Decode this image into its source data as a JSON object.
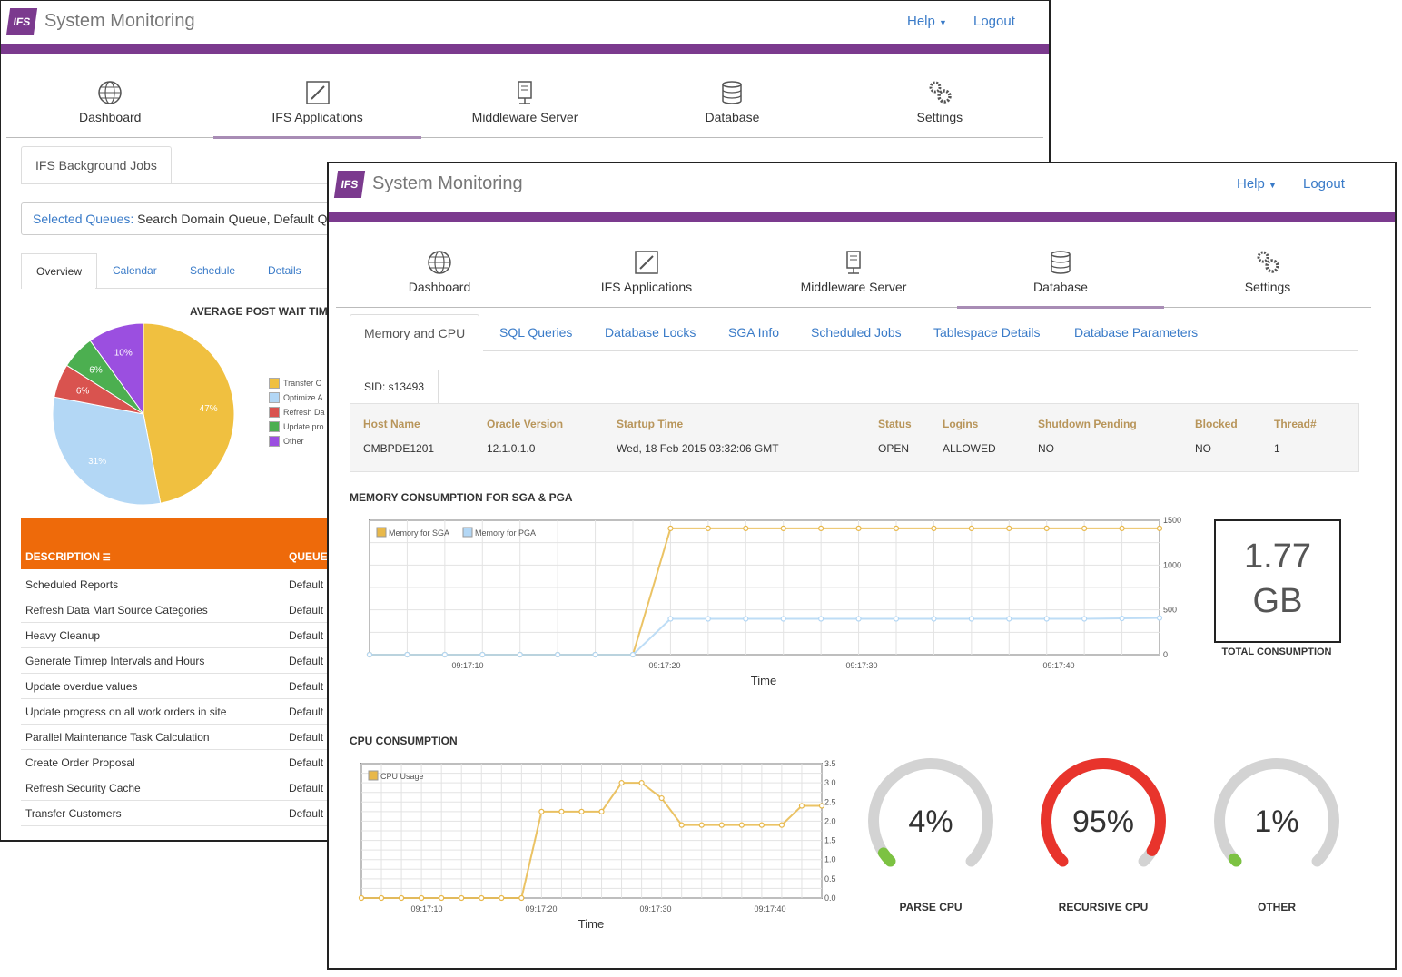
{
  "app": {
    "title": "System Monitoring",
    "logo_text": "IFS",
    "help": "Help",
    "logout": "Logout"
  },
  "nav": [
    {
      "label": "Dashboard",
      "icon": "globe-icon"
    },
    {
      "label": "IFS Applications",
      "icon": "ifs-logo-icon"
    },
    {
      "label": "Middleware Server",
      "icon": "server-icon"
    },
    {
      "label": "Database",
      "icon": "database-icon"
    },
    {
      "label": "Settings",
      "icon": "gears-icon"
    }
  ],
  "back": {
    "page_tab": "IFS Background Jobs",
    "selected_queues_label": "Selected Queues:",
    "selected_queues_value": " Search Domain Queue, Default Q",
    "tabs": [
      "Overview",
      "Calendar",
      "Schedule",
      "Details"
    ],
    "pie_title": "AVERAGE POST WAIT TIM",
    "pie": {
      "slices": [
        {
          "label": "47%",
          "value": 47,
          "color": "#f0c040",
          "legend": "Transfer C"
        },
        {
          "label": "31%",
          "value": 31,
          "color": "#b3d7f5",
          "legend": "Optimize A"
        },
        {
          "label": "6%",
          "value": 6,
          "color": "#d9534f",
          "legend": "Refresh Da"
        },
        {
          "label": "6%",
          "value": 6,
          "color": "#4caf50",
          "legend": "Update pro"
        },
        {
          "label": "10%",
          "value": 10,
          "color": "#9b4fe0",
          "legend": "Other"
        }
      ]
    },
    "table": {
      "col_description": "DESCRIPTION",
      "col_queue": "QUEUE",
      "rows": [
        {
          "d": "Scheduled Reports",
          "q": "Default"
        },
        {
          "d": "Refresh Data Mart Source Categories",
          "q": "Default"
        },
        {
          "d": "Heavy Cleanup",
          "q": "Default"
        },
        {
          "d": "Generate Timrep Intervals and Hours",
          "q": "Default"
        },
        {
          "d": "Update overdue values",
          "q": "Default"
        },
        {
          "d": "Update progress on all work orders in site",
          "q": "Default"
        },
        {
          "d": "Parallel Maintenance Task Calculation",
          "q": "Default"
        },
        {
          "d": "Create Order Proposal",
          "q": "Default"
        },
        {
          "d": "Refresh Security Cache",
          "q": "Default"
        },
        {
          "d": "Transfer Customers",
          "q": "Default"
        }
      ]
    }
  },
  "front": {
    "subtabs": [
      "Memory and CPU",
      "SQL Queries",
      "Database Locks",
      "SGA Info",
      "Scheduled Jobs",
      "Tablespace Details",
      "Database Parameters"
    ],
    "sid_tab": "SID: s13493",
    "info_headers": [
      "Host Name",
      "Oracle Version",
      "Startup Time",
      "Status",
      "Logins",
      "Shutdown Pending",
      "Blocked",
      "Thread#"
    ],
    "info_values": [
      "CMBPDE1201",
      "12.1.0.1.0",
      "Wed, 18 Feb 2015 03:32:06 GMT",
      "OPEN",
      "ALLOWED",
      "NO",
      "NO",
      "1"
    ],
    "mem_title": "MEMORY CONSUMPTION FOR SGA & PGA",
    "cpu_title": "CPU CONSUMPTION",
    "total_value": "1.77",
    "total_unit": "GB",
    "total_label": "TOTAL CONSUMPTION",
    "gauges": [
      {
        "value": "4%",
        "pct": 4,
        "label": "PARSE CPU",
        "color": "#7cc242"
      },
      {
        "value": "95%",
        "pct": 95,
        "label": "RECURSIVE CPU",
        "color": "#e8342c"
      },
      {
        "value": "1%",
        "pct": 1,
        "label": "OTHER",
        "color": "#7cc242"
      }
    ]
  },
  "chart_data": [
    {
      "type": "line",
      "title": "MEMORY CONSUMPTION FOR SGA & PGA",
      "xlabel": "Time",
      "ylabel": "",
      "x_ticks": [
        "09:17:10",
        "09:17:20",
        "09:17:30",
        "09:17:40"
      ],
      "y_ticks": [
        "1500",
        "1000",
        "500",
        "0"
      ],
      "ylim": [
        0,
        1500
      ],
      "series": [
        {
          "name": "Memory for SGA",
          "color": "#e8b84a",
          "values": [
            0,
            0,
            0,
            0,
            0,
            0,
            0,
            0,
            1410,
            1410,
            1410,
            1410,
            1410,
            1410,
            1410,
            1410,
            1410,
            1410,
            1410,
            1410,
            1410,
            1410
          ]
        },
        {
          "name": "Memory for PGA",
          "color": "#b3d7f5",
          "values": [
            0,
            0,
            0,
            0,
            0,
            0,
            0,
            0,
            400,
            400,
            400,
            400,
            400,
            400,
            400,
            400,
            400,
            400,
            400,
            400,
            405,
            410
          ]
        }
      ]
    },
    {
      "type": "line",
      "title": "CPU CONSUMPTION",
      "xlabel": "Time",
      "ylabel": "",
      "x_ticks": [
        "09:17:10",
        "09:17:20",
        "09:17:30",
        "09:17:40"
      ],
      "y_ticks": [
        "3.5",
        "3.0",
        "2.5",
        "2.0",
        "1.5",
        "1.0",
        "0.5",
        "0.0"
      ],
      "ylim": [
        0,
        3.5
      ],
      "series": [
        {
          "name": "CPU Usage",
          "color": "#e8b84a",
          "values": [
            0,
            0,
            0,
            0,
            0,
            0,
            0,
            0,
            0,
            2.25,
            2.25,
            2.25,
            2.25,
            3.0,
            3.0,
            2.6,
            1.9,
            1.9,
            1.9,
            1.9,
            1.9,
            1.9,
            2.4,
            2.4
          ]
        }
      ]
    }
  ]
}
